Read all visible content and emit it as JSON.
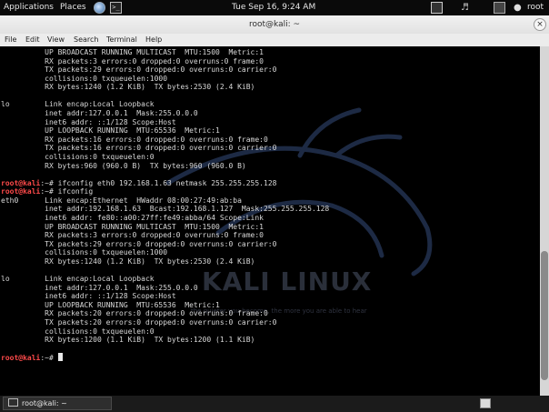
{
  "topbar": {
    "applications": "Applications",
    "places": "Places",
    "datetime": "Tue Sep 16,  9:24 AM",
    "user": "root"
  },
  "window": {
    "title": "root@kali: ~",
    "close": "×"
  },
  "menu": [
    "File",
    "Edit",
    "View",
    "Search",
    "Terminal",
    "Help"
  ],
  "terminal": {
    "lines": [
      {
        "text": "          UP BROADCAST RUNNING MULTICAST  MTU:1500  Metric:1"
      },
      {
        "text": "          RX packets:3 errors:0 dropped:0 overruns:0 frame:0"
      },
      {
        "text": "          TX packets:29 errors:0 dropped:0 overruns:0 carrier:0"
      },
      {
        "text": "          collisions:0 txqueuelen:1000"
      },
      {
        "text": "          RX bytes:1240 (1.2 KiB)  TX bytes:2530 (2.4 KiB)"
      },
      {
        "text": ""
      },
      {
        "text": "lo        Link encap:Local Loopback"
      },
      {
        "text": "          inet addr:127.0.0.1  Mask:255.0.0.0"
      },
      {
        "text": "          inet6 addr: ::1/128 Scope:Host"
      },
      {
        "text": "          UP LOOPBACK RUNNING  MTU:65536  Metric:1"
      },
      {
        "text": "          RX packets:16 errors:0 dropped:0 overruns:0 frame:0"
      },
      {
        "text": "          TX packets:16 errors:0 dropped:0 overruns:0 carrier:0"
      },
      {
        "text": "          collisions:0 txqueuelen:0"
      },
      {
        "text": "          RX bytes:960 (960.0 B)  TX bytes:960 (960.0 B)"
      },
      {
        "text": ""
      },
      {
        "prompt": "root@kali",
        "suffix": ":~# ",
        "text": "ifconfig eth0 192.168.1.63 netmask 255.255.255.128"
      },
      {
        "prompt": "root@kali",
        "suffix": ":~# ",
        "text": "ifconfig"
      },
      {
        "text": "eth0      Link encap:Ethernet  HWaddr 08:00:27:49:ab:ba"
      },
      {
        "text": "          inet addr:192.168.1.63  Bcast:192.168.1.127  Mask:255.255.255.128"
      },
      {
        "text": "          inet6 addr: fe80::a00:27ff:fe49:abba/64 Scope:Link"
      },
      {
        "text": "          UP BROADCAST RUNNING MULTICAST  MTU:1500  Metric:1"
      },
      {
        "text": "          RX packets:3 errors:0 dropped:0 overruns:0 frame:0"
      },
      {
        "text": "          TX packets:29 errors:0 dropped:0 overruns:0 carrier:0"
      },
      {
        "text": "          collisions:0 txqueuelen:1000"
      },
      {
        "text": "          RX bytes:1240 (1.2 KiB)  TX bytes:2530 (2.4 KiB)"
      },
      {
        "text": ""
      },
      {
        "text": "lo        Link encap:Local Loopback"
      },
      {
        "text": "          inet addr:127.0.0.1  Mask:255.0.0.0"
      },
      {
        "text": "          inet6 addr: ::1/128 Scope:Host"
      },
      {
        "text": "          UP LOOPBACK RUNNING  MTU:65536  Metric:1"
      },
      {
        "text": "          RX packets:20 errors:0 dropped:0 overruns:0 frame:0"
      },
      {
        "text": "          TX packets:20 errors:0 dropped:0 overruns:0 carrier:0"
      },
      {
        "text": "          collisions:0 txqueuelen:0"
      },
      {
        "text": "          RX bytes:1200 (1.1 KiB)  TX bytes:1200 (1.1 KiB)"
      },
      {
        "text": ""
      },
      {
        "prompt": "root@kali",
        "suffix": ":~# ",
        "text": "",
        "cursor": true
      }
    ]
  },
  "watermark": {
    "logo": "KALI LINUX",
    "tagline": "the quieter you become, the more you are able to hear"
  },
  "scroll": {
    "position": 0.93,
    "visible_fraction": 0.37
  },
  "taskbar": {
    "item": "root@kali: ~"
  },
  "colors": {
    "prompt": "#ff4a4a",
    "terminal_bg": "#000000",
    "terminal_fg": "#d8d8d8"
  }
}
